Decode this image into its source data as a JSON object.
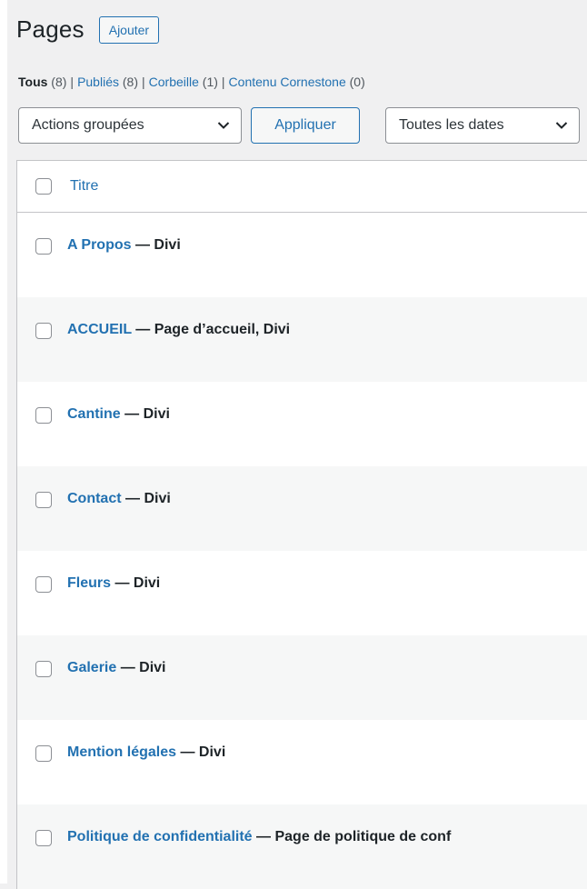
{
  "header": {
    "title": "Pages",
    "add_label": "Ajouter"
  },
  "filters": [
    {
      "label": "Tous",
      "count": "(8)",
      "current": true
    },
    {
      "label": "Publiés",
      "count": "(8)",
      "current": false
    },
    {
      "label": "Corbeille",
      "count": "(1)",
      "current": false
    },
    {
      "label": "Contenu Cornestone",
      "count": "(0)",
      "current": false
    }
  ],
  "filter_separator": "|",
  "toolbar": {
    "bulk_actions_selected": "Actions groupées",
    "apply_label": "Appliquer",
    "dates_selected": "Toutes les dates"
  },
  "table": {
    "title_column": "Titre",
    "state_prefix": " — ",
    "rows": [
      {
        "title": "A Propos",
        "state": "Divi"
      },
      {
        "title": "ACCUEIL",
        "state": "Page d’accueil, Divi"
      },
      {
        "title": "Cantine",
        "state": "Divi"
      },
      {
        "title": "Contact",
        "state": "Divi"
      },
      {
        "title": "Fleurs",
        "state": "Divi"
      },
      {
        "title": "Galerie",
        "state": "Divi"
      },
      {
        "title": "Mention légales",
        "state": "Divi"
      },
      {
        "title": "Politique de confidentialité",
        "state": "Page de politique de conf"
      }
    ]
  },
  "colors": {
    "link": "#2271b1",
    "text": "#1d2327",
    "background": "#f0f0f1",
    "row_alt": "#f6f7f7"
  },
  "icons": {
    "dropdown": "chevron-down-icon"
  }
}
